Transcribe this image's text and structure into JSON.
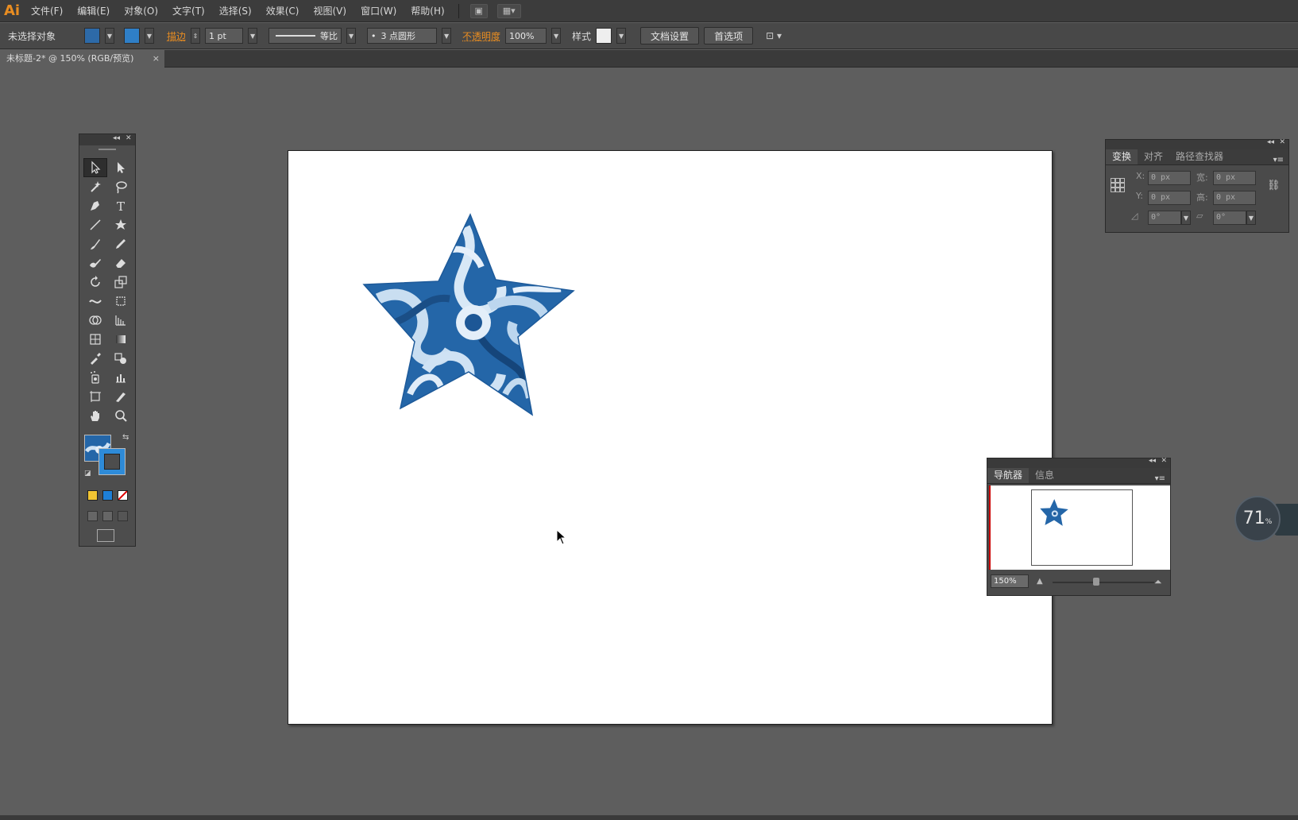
{
  "app": {
    "logo": "Ai"
  },
  "menu": {
    "items": [
      "文件(F)",
      "编辑(E)",
      "对象(O)",
      "文字(T)",
      "选择(S)",
      "效果(C)",
      "视图(V)",
      "窗口(W)",
      "帮助(H)"
    ]
  },
  "control_bar": {
    "selection_status": "未选择对象",
    "stroke_label": "描边",
    "stroke_weight": "1 pt",
    "stroke_profile": "等比",
    "brush": "3 点圆形",
    "opacity_label": "不透明度",
    "opacity_value": "100%",
    "style_label": "样式",
    "doc_setup_button": "文档设置",
    "preferences_button": "首选项"
  },
  "document": {
    "tab_title": "未标题-2* @ 150% (RGB/预览)",
    "tab_close": "×"
  },
  "transform_panel": {
    "tabs": [
      "变换",
      "对齐",
      "路径查找器"
    ],
    "x_label": "X:",
    "x_value": "0 px",
    "y_label": "Y:",
    "y_value": "0 px",
    "w_label": "宽:",
    "w_value": "0 px",
    "h_label": "高:",
    "h_value": "0 px",
    "rotate_value": "0°",
    "shear_value": "0°"
  },
  "navigator_panel": {
    "tabs": [
      "导航器",
      "信息"
    ],
    "zoom": "150%"
  },
  "gauge": {
    "value": "71",
    "unit": "%"
  },
  "colors": {
    "accent_orange": "#e98d21",
    "pattern_dark_blue": "#1f5a9c",
    "pattern_light_blue": "#a9cbe8"
  }
}
